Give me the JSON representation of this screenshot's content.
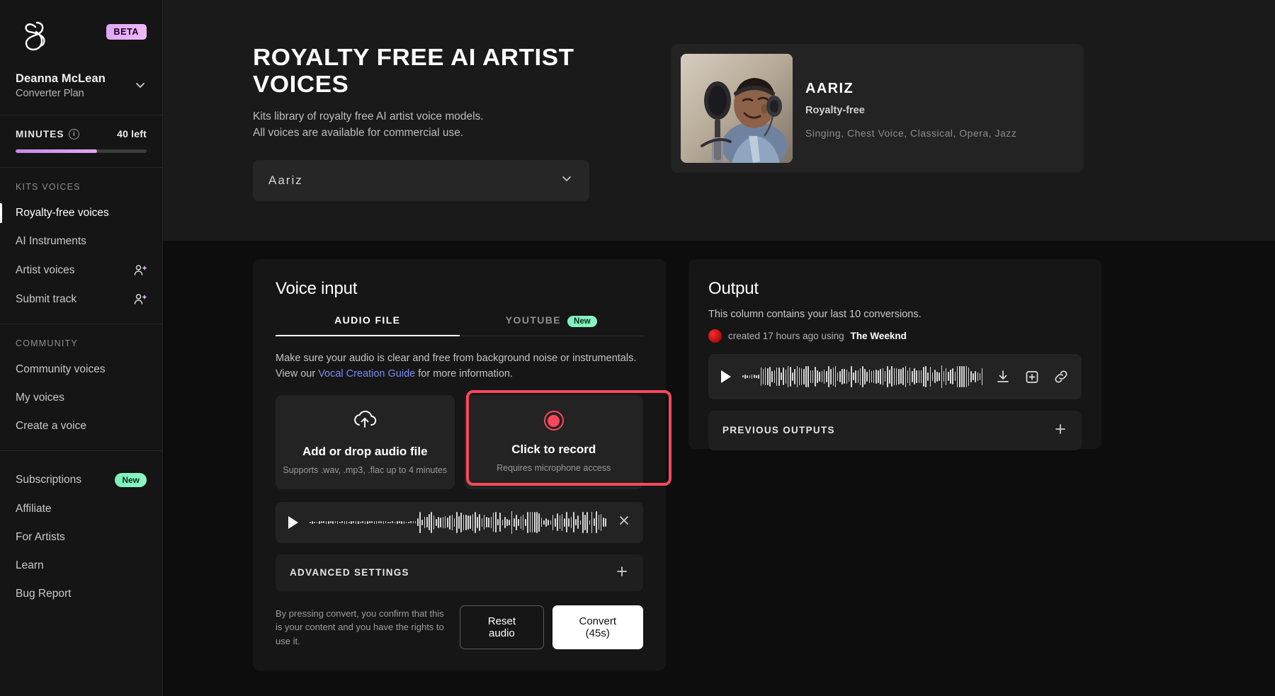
{
  "sidebar": {
    "badge": "BETA",
    "user_name": "Deanna McLean",
    "user_plan": "Converter Plan",
    "minutes_label": "MINUTES",
    "minutes_left": "40 left",
    "minutes_progress_pct": 62,
    "groups": [
      {
        "title": "KITS VOICES",
        "items": [
          {
            "label": "Royalty-free voices",
            "active": true,
            "icon": "",
            "badge": ""
          },
          {
            "label": "AI Instruments",
            "active": false,
            "icon": "",
            "badge": ""
          },
          {
            "label": "Artist voices",
            "active": false,
            "icon": "person-sparkle-icon",
            "badge": ""
          },
          {
            "label": "Submit track",
            "active": false,
            "icon": "person-sparkle-icon",
            "badge": ""
          }
        ]
      },
      {
        "title": "COMMUNITY",
        "items": [
          {
            "label": "Community voices",
            "active": false,
            "icon": "",
            "badge": ""
          },
          {
            "label": "My voices",
            "active": false,
            "icon": "",
            "badge": ""
          },
          {
            "label": "Create a voice",
            "active": false,
            "icon": "",
            "badge": ""
          }
        ]
      },
      {
        "title": "",
        "items": [
          {
            "label": "Subscriptions",
            "active": false,
            "icon": "",
            "badge": "New"
          },
          {
            "label": "Affiliate",
            "active": false,
            "icon": "",
            "badge": ""
          },
          {
            "label": "For Artists",
            "active": false,
            "icon": "",
            "badge": ""
          },
          {
            "label": "Learn",
            "active": false,
            "icon": "",
            "badge": ""
          },
          {
            "label": "Bug Report",
            "active": false,
            "icon": "",
            "badge": ""
          }
        ]
      }
    ]
  },
  "hero": {
    "title": "ROYALTY FREE AI ARTIST VOICES",
    "subtitle_line1": "Kits library of royalty free AI artist voice models.",
    "subtitle_line2": "All voices are available for commercial use.",
    "voice_selected": "Aariz"
  },
  "artist_card": {
    "name": "AARIZ",
    "type": "Royalty-free",
    "tags": "Singing, Chest Voice, Classical, Opera, Jazz"
  },
  "voice_input": {
    "heading": "Voice input",
    "tabs": [
      {
        "label": "AUDIO FILE",
        "active": true,
        "badge": ""
      },
      {
        "label": "YOUTUBE",
        "active": false,
        "badge": "New"
      }
    ],
    "hint_part1": "Make sure your audio is clear and free from background noise or instrumentals. View our",
    "hint_link": "Vocal Creation Guide",
    "hint_part2": "for more information.",
    "upload": {
      "title": "Add or drop audio file",
      "subtitle": "Supports .wav, .mp3, .flac up to 4 minutes",
      "icon": "cloud-upload-icon"
    },
    "record": {
      "title": "Click to record",
      "subtitle": "Requires microphone access",
      "icon": "record-circle-icon",
      "highlighted": true,
      "highlight_color": "#f9485b"
    },
    "advanced_label": "ADVANCED SETTINGS",
    "footer_note": "By pressing convert, you confirm that this is your content and you have the rights to use it.",
    "reset_label": "Reset audio",
    "convert_label": "Convert (45s)"
  },
  "output": {
    "heading": "Output",
    "subtitle": "This column contains your last 10 conversions.",
    "meta_prefix": "created 17 hours ago using",
    "meta_artist": "The Weeknd",
    "actions": [
      "download-icon",
      "save-to-library-icon",
      "copy-link-icon"
    ],
    "previous_label": "PREVIOUS OUTPUTS"
  },
  "colors": {
    "accent_purple": "#e0a6f5",
    "accent_green": "#7bf0b8",
    "highlight_red": "#f9485b",
    "link_blue": "#7b8cf0"
  }
}
